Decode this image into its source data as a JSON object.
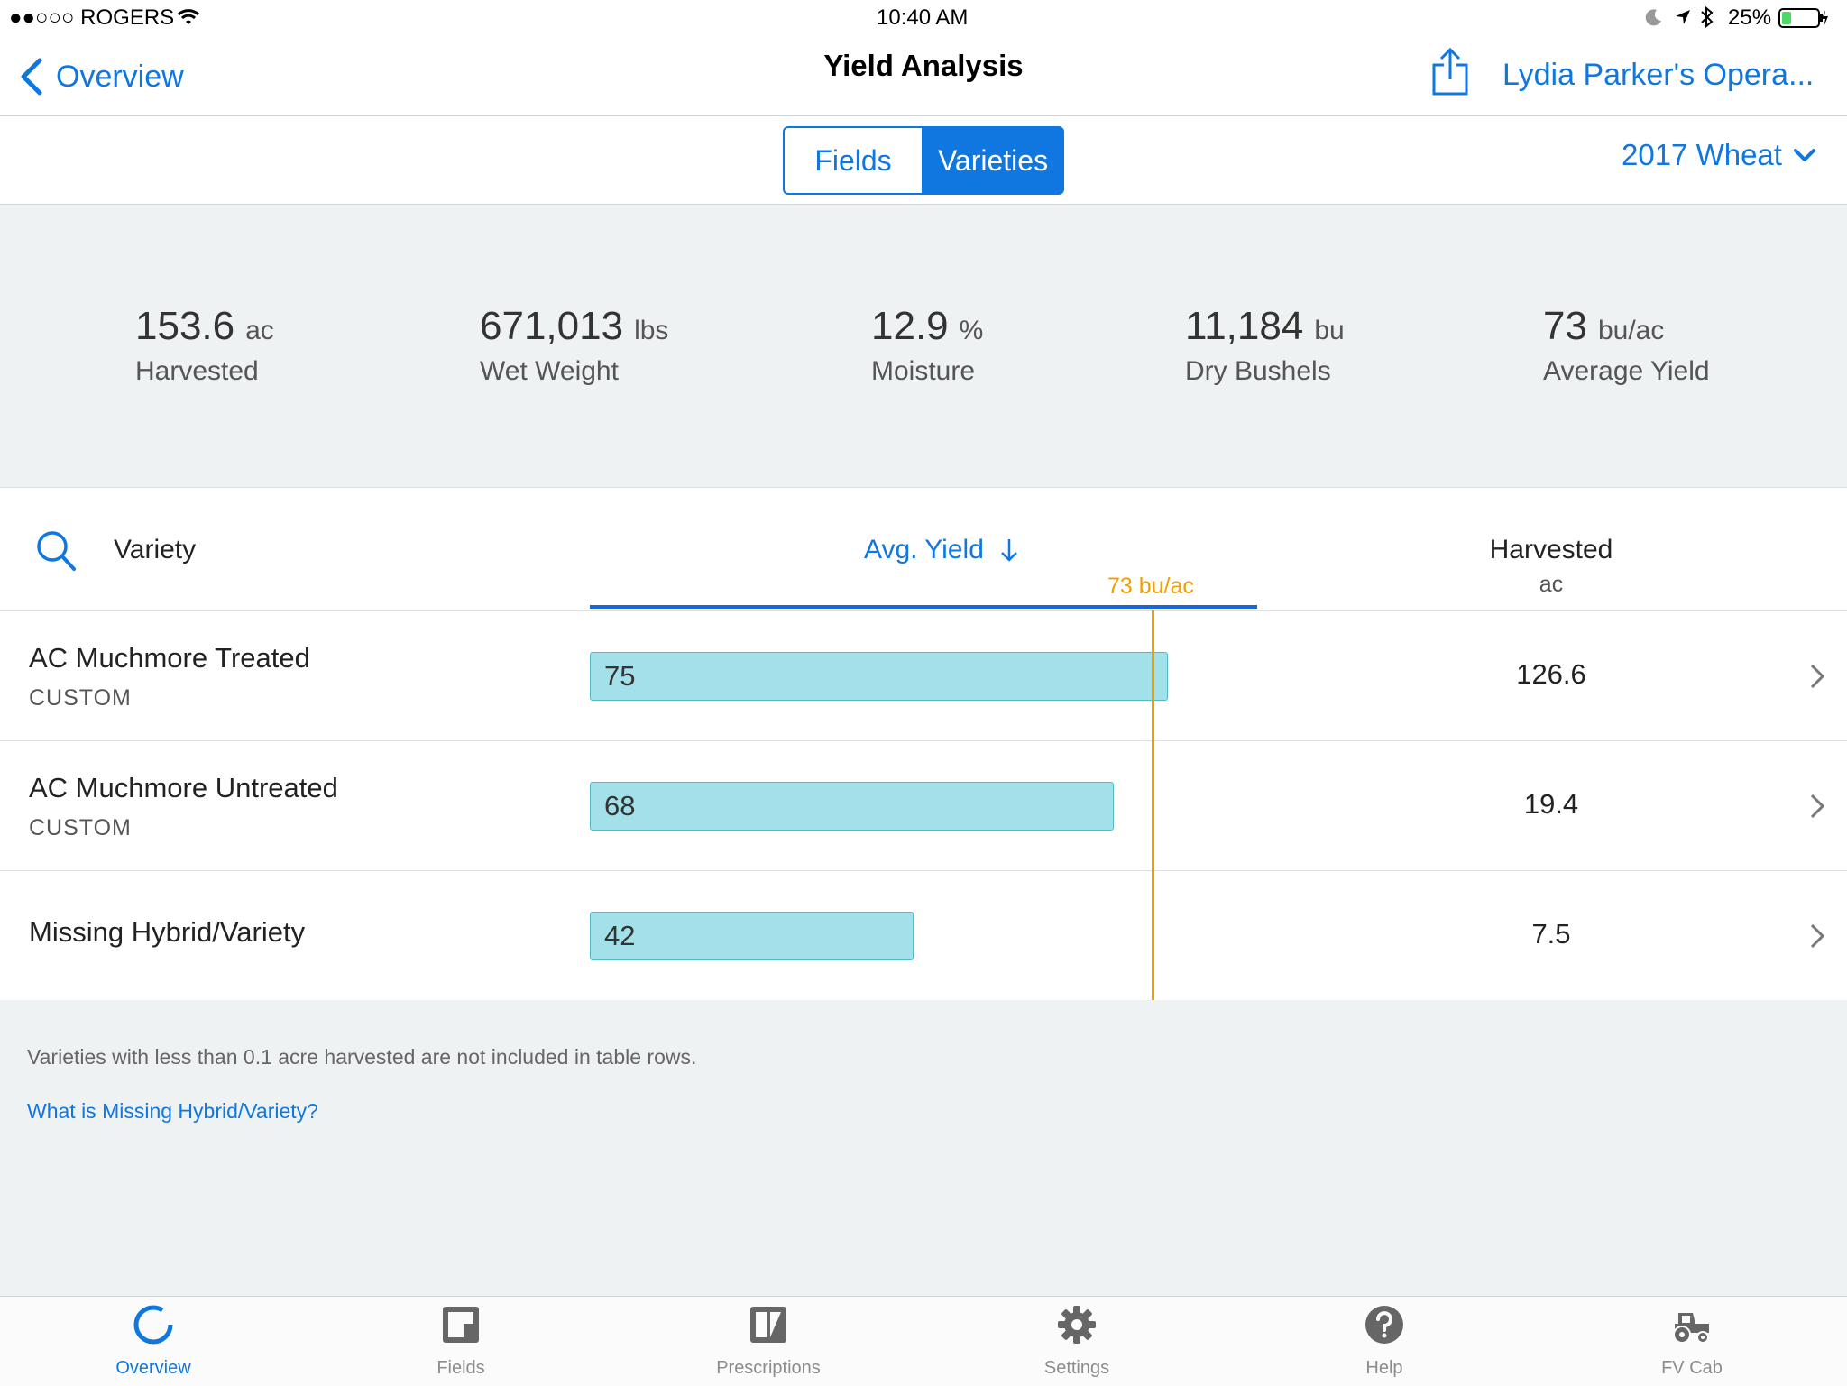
{
  "status_bar": {
    "carrier": "●●○○○ ROGERS",
    "time": "10:40 AM",
    "battery": "25%"
  },
  "nav": {
    "back_label": "Overview",
    "title": "Yield Analysis",
    "operation": "Lydia Parker's Opera..."
  },
  "segments": {
    "fields": "Fields",
    "varieties": "Varieties",
    "selected": "Varieties"
  },
  "season_selector": "2017 Wheat",
  "summary": [
    {
      "value": "153.6",
      "unit": "ac",
      "label": "Harvested"
    },
    {
      "value": "671,013",
      "unit": "lbs",
      "label": "Wet Weight"
    },
    {
      "value": "12.9",
      "unit": "%",
      "label": "Moisture"
    },
    {
      "value": "11,184",
      "unit": "bu",
      "label": "Dry Bushels"
    },
    {
      "value": "73",
      "unit": "bu/ac",
      "label": "Average Yield"
    }
  ],
  "table": {
    "col_variety": "Variety",
    "col_avg_yield": "Avg. Yield",
    "col_harvested": "Harvested",
    "col_harvested_unit": "ac",
    "average_marker": "73 bu/ac",
    "average_value": 73,
    "scale_max": 86,
    "rows": [
      {
        "name": "AC Muchmore Treated",
        "type": "CUSTOM",
        "avg_yield": "75",
        "avg_yield_value": 75,
        "harvested": "126.6"
      },
      {
        "name": "AC Muchmore Untreated",
        "type": "CUSTOM",
        "avg_yield": "68",
        "avg_yield_value": 68,
        "harvested": "19.4"
      },
      {
        "name": "Missing Hybrid/Variety",
        "type": "",
        "avg_yield": "42",
        "avg_yield_value": 42,
        "harvested": "7.5"
      }
    ]
  },
  "footer": {
    "note": "Varieties with less than 0.1 acre harvested are not included in table rows.",
    "link": "What is Missing Hybrid/Variety?"
  },
  "tabs": [
    {
      "label": "Overview",
      "icon": "overview-ring-icon",
      "active": true
    },
    {
      "label": "Fields",
      "icon": "fields-icon",
      "active": false
    },
    {
      "label": "Prescriptions",
      "icon": "prescriptions-icon",
      "active": false
    },
    {
      "label": "Settings",
      "icon": "gear-icon",
      "active": false
    },
    {
      "label": "Help",
      "icon": "help-icon",
      "active": false
    },
    {
      "label": "FV Cab",
      "icon": "tractor-icon",
      "active": false
    }
  ],
  "colors": {
    "accent": "#1177e0",
    "average_line": "#f0a000",
    "bar_fill": "#a3e1ea",
    "summary_bg": "#eff2f3"
  }
}
